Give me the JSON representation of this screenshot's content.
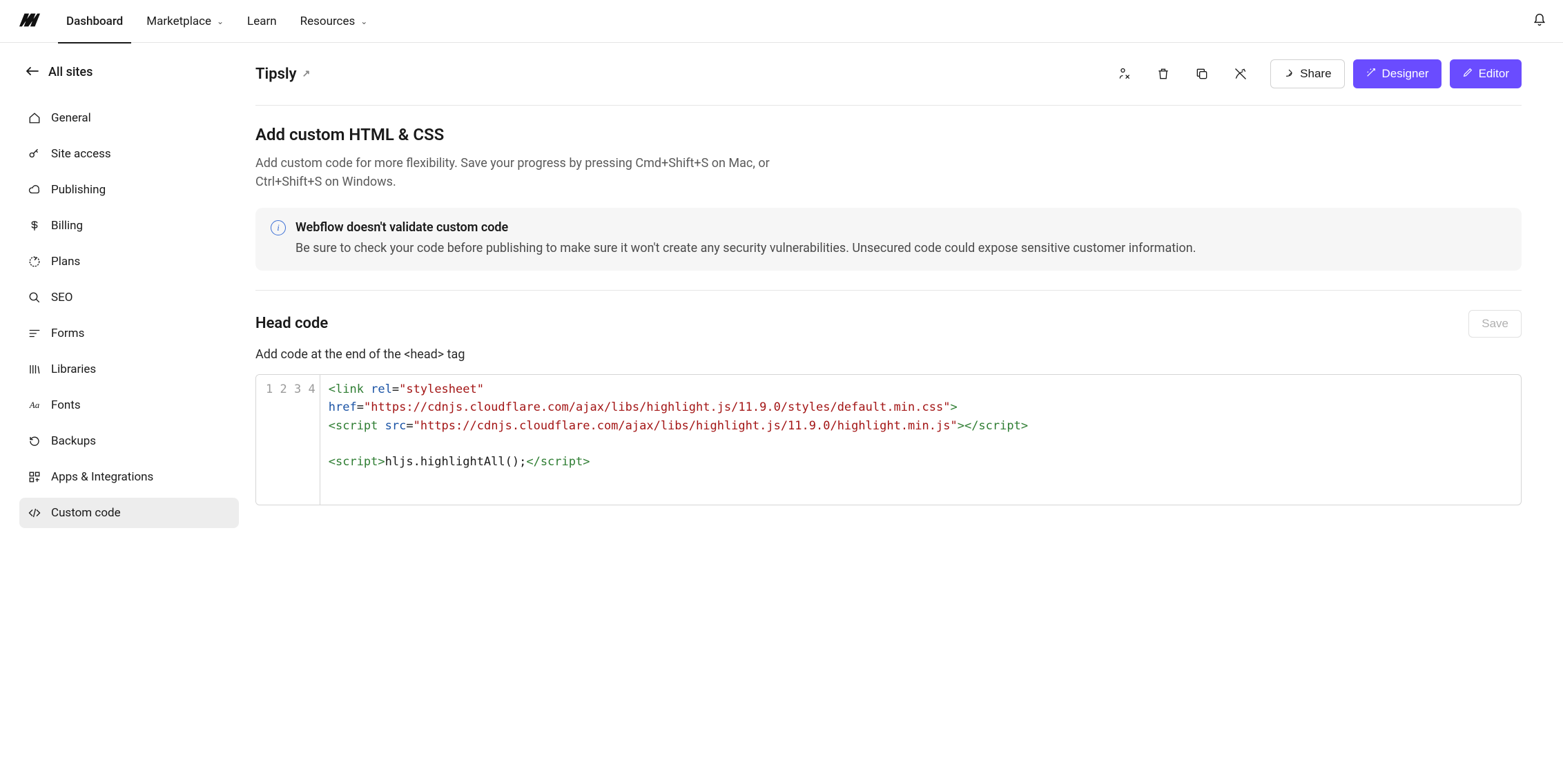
{
  "topnav": {
    "items": [
      {
        "label": "Dashboard",
        "dropdown": false,
        "active": true
      },
      {
        "label": "Marketplace",
        "dropdown": true,
        "active": false
      },
      {
        "label": "Learn",
        "dropdown": false,
        "active": false
      },
      {
        "label": "Resources",
        "dropdown": true,
        "active": false
      }
    ]
  },
  "sidebar": {
    "back_label": "All sites",
    "items": [
      {
        "label": "General",
        "icon": "home-icon"
      },
      {
        "label": "Site access",
        "icon": "key-icon"
      },
      {
        "label": "Publishing",
        "icon": "cloud-icon"
      },
      {
        "label": "Billing",
        "icon": "dollar-icon"
      },
      {
        "label": "Plans",
        "icon": "target-icon"
      },
      {
        "label": "SEO",
        "icon": "search-icon"
      },
      {
        "label": "Forms",
        "icon": "lines-icon"
      },
      {
        "label": "Libraries",
        "icon": "library-icon"
      },
      {
        "label": "Fonts",
        "icon": "font-icon"
      },
      {
        "label": "Backups",
        "icon": "undo-icon"
      },
      {
        "label": "Apps & Integrations",
        "icon": "grid-plus-icon"
      },
      {
        "label": "Custom code",
        "icon": "code-icon",
        "active": true
      }
    ]
  },
  "header": {
    "site_name": "Tipsly",
    "share_label": "Share",
    "designer_label": "Designer",
    "editor_label": "Editor"
  },
  "section": {
    "title": "Add custom HTML & CSS",
    "desc": "Add custom code for more flexibility. Save your progress by pressing Cmd+Shift+S on Mac, or Ctrl+Shift+S on Windows."
  },
  "info": {
    "title": "Webflow doesn't validate custom code",
    "text": "Be sure to check your code before publishing to make sure it won't create any security vulnerabilities. Unsecured code could expose sensitive customer information."
  },
  "head_code": {
    "title": "Head code",
    "save_label": "Save",
    "desc": "Add code at the end of the <head> tag",
    "lines": [
      "1",
      "2",
      "3",
      "4"
    ],
    "code": {
      "l1_tag1": "<link",
      "l1_attr1": " rel",
      "l1_eq1": "=",
      "l1_str1": "\"stylesheet\"",
      "l1_attr2": "href",
      "l1_eq2": "=",
      "l1_str2": "\"https://cdnjs.cloudflare.com/ajax/libs/highlight.js/11.9.0/styles/default.min.css\"",
      "l1_tag2": ">",
      "l2_tag1": "<script",
      "l2_attr1": " src",
      "l2_eq1": "=",
      "l2_str1": "\"https://cdnjs.cloudflare.com/ajax/libs/highlight.js/11.9.0/highlight.min.js\"",
      "l2_tag2": ">",
      "l2_tag3": "</script>",
      "l4_tag1": "<script>",
      "l4_plain": "hljs.highlightAll();",
      "l4_tag2": "</script>"
    }
  }
}
